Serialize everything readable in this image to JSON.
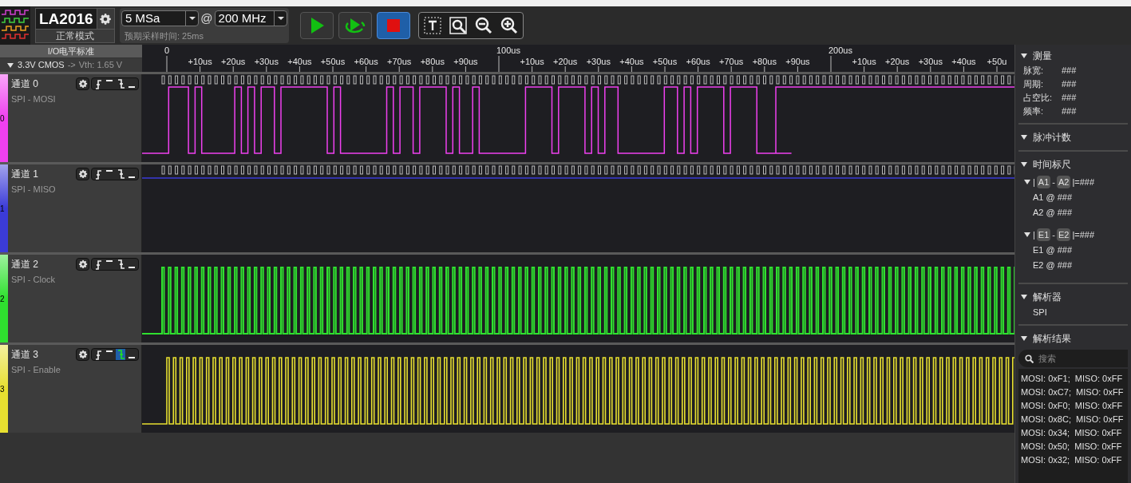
{
  "toolbar": {
    "device": "LA2016",
    "mode": "正常模式",
    "sample_depth": "5 MSa",
    "at": "@",
    "sample_rate": "200 MHz",
    "estimated_time": "预期采样时间: 25ms",
    "run_buttons": [
      {
        "kind": "start",
        "active": false
      },
      {
        "kind": "repeat",
        "active": false
      },
      {
        "kind": "stop",
        "active": true
      }
    ]
  },
  "io_standard": {
    "title": "I/O电平标准",
    "value": "3.3V CMOS",
    "arrow": "->",
    "vth": "Vth: 1.65 V",
    "expanded": true
  },
  "ruler": {
    "ticks": [
      {
        "kind": "major",
        "label": "0"
      },
      {
        "kind": "minor",
        "label": "+10us"
      },
      {
        "kind": "minor",
        "label": "+20us"
      },
      {
        "kind": "minor",
        "label": "+30us"
      },
      {
        "kind": "minor",
        "label": "+40us"
      },
      {
        "kind": "minor",
        "label": "+50us"
      },
      {
        "kind": "minor",
        "label": "+60us"
      },
      {
        "kind": "minor",
        "label": "+70us"
      },
      {
        "kind": "minor",
        "label": "+80us"
      },
      {
        "kind": "minor",
        "label": "+90us"
      },
      {
        "kind": "major",
        "label": "100us"
      },
      {
        "kind": "minor",
        "label": "+10us"
      },
      {
        "kind": "minor",
        "label": "+20us"
      },
      {
        "kind": "minor",
        "label": "+30us"
      },
      {
        "kind": "minor",
        "label": "+40us"
      },
      {
        "kind": "minor",
        "label": "+50us"
      },
      {
        "kind": "minor",
        "label": "+60us"
      },
      {
        "kind": "minor",
        "label": "+70us"
      },
      {
        "kind": "minor",
        "label": "+80us"
      },
      {
        "kind": "minor",
        "label": "+90us"
      },
      {
        "kind": "major",
        "label": "200us"
      },
      {
        "kind": "minor",
        "label": "+10us"
      },
      {
        "kind": "minor",
        "label": "+20us"
      },
      {
        "kind": "minor",
        "label": "+30us"
      },
      {
        "kind": "minor",
        "label": "+40us"
      },
      {
        "kind": "minor",
        "label": "+50u"
      }
    ]
  },
  "channels": [
    {
      "index": "0",
      "name": "通道 0",
      "label": "SPI - MOSI",
      "color": "#f040f0",
      "kind": "data",
      "triggers": [
        {
          "kind": "rising",
          "selected": false
        },
        {
          "kind": "high",
          "selected": false
        },
        {
          "kind": "falling",
          "selected": false
        },
        {
          "kind": "low",
          "selected": false
        }
      ]
    },
    {
      "index": "1",
      "name": "通道 1",
      "label": "SPI - MISO",
      "color": "#3b3bd8",
      "kind": "idle",
      "triggers": [
        {
          "kind": "rising",
          "selected": false
        },
        {
          "kind": "high",
          "selected": false
        },
        {
          "kind": "falling",
          "selected": false
        },
        {
          "kind": "low",
          "selected": false
        }
      ]
    },
    {
      "index": "2",
      "name": "通道 2",
      "label": "SPI - Clock",
      "color": "#2fe02f",
      "kind": "clock",
      "triggers": [
        {
          "kind": "rising",
          "selected": false
        },
        {
          "kind": "high",
          "selected": false
        },
        {
          "kind": "falling",
          "selected": false
        },
        {
          "kind": "low",
          "selected": false
        }
      ]
    },
    {
      "index": "3",
      "name": "通道 3",
      "label": "SPI - Enable",
      "color": "#e8e030",
      "kind": "enable",
      "triggers": [
        {
          "kind": "rising",
          "selected": false
        },
        {
          "kind": "high",
          "selected": false
        },
        {
          "kind": "falling",
          "selected": true
        },
        {
          "kind": "low",
          "selected": false
        }
      ]
    }
  ],
  "side_panel": {
    "measure": {
      "title": "测量",
      "expanded": true,
      "rows": [
        {
          "label": "脉宽:",
          "value": "###"
        },
        {
          "label": "周期:",
          "value": "###"
        },
        {
          "label": "占空比:",
          "value": "###"
        },
        {
          "label": "频率:",
          "value": "###"
        }
      ]
    },
    "pulse_count": {
      "title": "脉冲计数",
      "expanded": true
    },
    "time_cursors": {
      "title": "时间标尺",
      "expanded": true,
      "groups": [
        {
          "expanded": true,
          "parts": [
            {
              "kind": "text",
              "text": "|"
            },
            {
              "kind": "tag",
              "text": "A1"
            },
            {
              "kind": "text",
              "text": "-"
            },
            {
              "kind": "tag",
              "text": "A2"
            },
            {
              "kind": "text",
              "text": "|=###"
            }
          ],
          "items": [
            "A1 @ ###",
            "A2 @ ###"
          ]
        },
        {
          "expanded": true,
          "parts": [
            {
              "kind": "text",
              "text": "|"
            },
            {
              "kind": "tag",
              "text": "E1"
            },
            {
              "kind": "text",
              "text": "-"
            },
            {
              "kind": "tag",
              "text": "E2"
            },
            {
              "kind": "text",
              "text": "|=###"
            }
          ],
          "items": [
            "E1 @ ###",
            "E2 @ ###"
          ]
        }
      ]
    },
    "decoder": {
      "title": "解析器",
      "expanded": true,
      "items": [
        "SPI"
      ]
    },
    "results": {
      "title": "解析结果",
      "expanded": true,
      "search_placeholder": "搜索",
      "rows": [
        "MOSI: 0xF1;  MISO: 0xFF",
        "MOSI: 0xC7;  MISO: 0xFF",
        "MOSI: 0xF0;  MISO: 0xFF",
        "MOSI: 0x8C;  MISO: 0xFF",
        "MOSI: 0x34;  MISO: 0xFF",
        "MOSI: 0x50;  MISO: 0xFF",
        "MOSI: 0x32;  MISO: 0xFF"
      ]
    }
  }
}
